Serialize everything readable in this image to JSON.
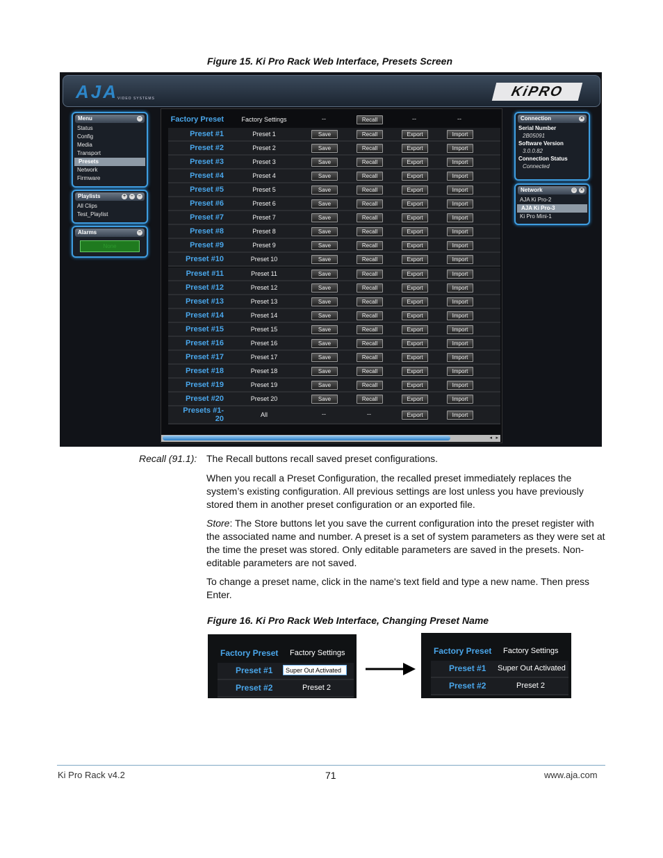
{
  "figure15": {
    "caption": "Figure 15. Ki Pro Rack Web Interface, Presets Screen",
    "logo": "AJA",
    "logo_sub": "VIDEO SYSTEMS",
    "product_logo": "KiPRO",
    "menu": {
      "title": "Menu",
      "items": [
        "Status",
        "Config",
        "Media",
        "Transport",
        "Presets",
        "Network",
        "Firmware"
      ],
      "selected": "Presets"
    },
    "playlists": {
      "title": "Playlists",
      "items": [
        "All Clips",
        "Test_Playlist"
      ]
    },
    "alarms": {
      "title": "Alarms",
      "value": "None"
    },
    "connection": {
      "title": "Connection",
      "serial_label": "Serial Number",
      "serial_value": "2B05091",
      "software_label": "Software Version",
      "software_value": "3.0.0.82",
      "status_label": "Connection Status",
      "status_value": "Connected"
    },
    "network": {
      "title": "Network",
      "items": [
        "AJA Ki Pro-2",
        "AJA Ki Pro-3",
        "Ki Pro Mini-1"
      ],
      "selected": "AJA Ki Pro-3"
    },
    "buttons": {
      "save": "Save",
      "recall": "Recall",
      "export": "Export",
      "import": "Import",
      "dash": "--"
    },
    "factory_row": {
      "label": "Factory Preset",
      "name": "Factory Settings"
    },
    "presets": [
      {
        "label": "Preset #1",
        "name": "Preset 1"
      },
      {
        "label": "Preset #2",
        "name": "Preset 2"
      },
      {
        "label": "Preset #3",
        "name": "Preset 3"
      },
      {
        "label": "Preset #4",
        "name": "Preset 4"
      },
      {
        "label": "Preset #5",
        "name": "Preset 5"
      },
      {
        "label": "Preset #6",
        "name": "Preset 6"
      },
      {
        "label": "Preset #7",
        "name": "Preset 7"
      },
      {
        "label": "Preset #8",
        "name": "Preset 8"
      },
      {
        "label": "Preset #9",
        "name": "Preset 9"
      },
      {
        "label": "Preset #10",
        "name": "Preset 10"
      },
      {
        "label": "Preset #11",
        "name": "Preset 11"
      },
      {
        "label": "Preset #12",
        "name": "Preset 12"
      },
      {
        "label": "Preset #13",
        "name": "Preset 13"
      },
      {
        "label": "Preset #14",
        "name": "Preset 14"
      },
      {
        "label": "Preset #15",
        "name": "Preset 15"
      },
      {
        "label": "Preset #16",
        "name": "Preset 16"
      },
      {
        "label": "Preset #17",
        "name": "Preset 17"
      },
      {
        "label": "Preset #18",
        "name": "Preset 18"
      },
      {
        "label": "Preset #19",
        "name": "Preset 19"
      },
      {
        "label": "Preset #20",
        "name": "Preset 20"
      }
    ],
    "all_row": {
      "label_line1": "Presets #1-",
      "label_line2": "20",
      "name": "All"
    }
  },
  "text": {
    "recall_term": "Recall (91.1):",
    "recall_desc": "The Recall buttons recall saved preset configurations.",
    "para1": "When you recall a Preset Configuration, the recalled preset immediately replaces the system’s existing configuration. All previous settings are lost unless you have previously stored them in another preset configuration or an exported file.",
    "store_term": "Store",
    "para2": ": The Store buttons let you save the current configuration into the preset register with the associated name and number. A preset is a set of system parameters as they were set at the time the preset was stored. Only editable parameters are saved in the presets. Non-editable parameters are not saved.",
    "para3": "To change a preset name, click in the name's text field and type a new name. Then press Enter."
  },
  "figure16": {
    "caption": "Figure 16. Ki Pro Rack Web Interface, Changing Preset Name",
    "factory_label": "Factory Preset",
    "factory_name": "Factory Settings",
    "p1_label": "Preset #1",
    "p1_edit_value": "Super Out Activated",
    "p1_new_name": "Super Out Activated",
    "p2_label": "Preset #2",
    "p2_name": "Preset 2"
  },
  "footer": {
    "left": "Ki Pro Rack v4.2",
    "page": "71",
    "right": "www.aja.com"
  },
  "colors": {
    "accent_blue": "#4aa6ea",
    "panel_border": "#3f9de0",
    "background": "#111318"
  }
}
